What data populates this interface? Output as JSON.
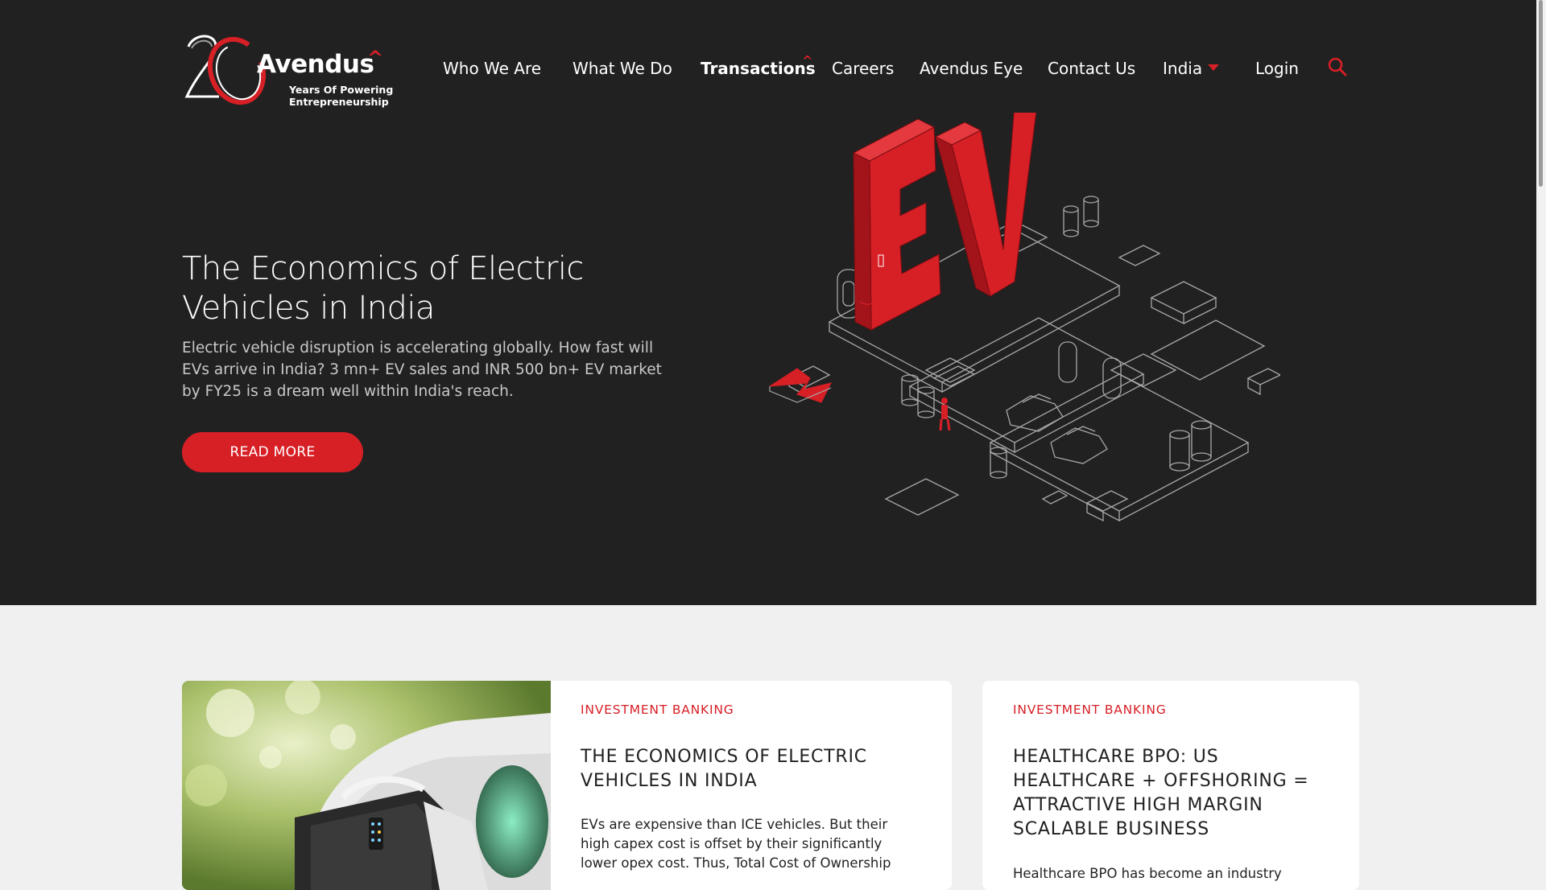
{
  "brand": {
    "name": "Avendus",
    "anniversary_number": "20",
    "tagline_line1": "Years Of Powering",
    "tagline_line2": "Entrepreneurship"
  },
  "nav": {
    "items": [
      {
        "label": "Who We Are"
      },
      {
        "label": "What We Do"
      },
      {
        "label": "Transactions"
      },
      {
        "label": "Careers"
      },
      {
        "label": "Avendus Eye"
      },
      {
        "label": "Contact Us"
      },
      {
        "label": "India"
      },
      {
        "label": "Login"
      }
    ]
  },
  "hero": {
    "title": "The Economics of Electric Vehicles in India",
    "description": "Electric vehicle disruption is accelerating globally. How fast will EVs arrive in India? 3 mn+ EV sales and INR 500 bn+ EV market by FY25 is a dream well within India's reach.",
    "button_label": "READ MORE",
    "illustration_text": "EV"
  },
  "cards": [
    {
      "category": "INVESTMENT BANKING",
      "title": "THE ECONOMICS OF ELECTRIC VEHICLES IN INDIA",
      "text": "EVs are expensive than ICE vehicles. But their high capex cost is offset by their significantly lower opex cost. Thus, Total Cost of Ownership"
    },
    {
      "category": "INVESTMENT BANKING",
      "title": "HEALTHCARE BPO: US HEALTHCARE + OFFSHORING = ATTRACTIVE HIGH MARGIN SCALABLE BUSINESS",
      "text": "Healthcare BPO has become an industry"
    }
  ],
  "colors": {
    "accent": "#d71f26",
    "hero_bg": "#212121",
    "page_bg": "#f0f0f0"
  }
}
